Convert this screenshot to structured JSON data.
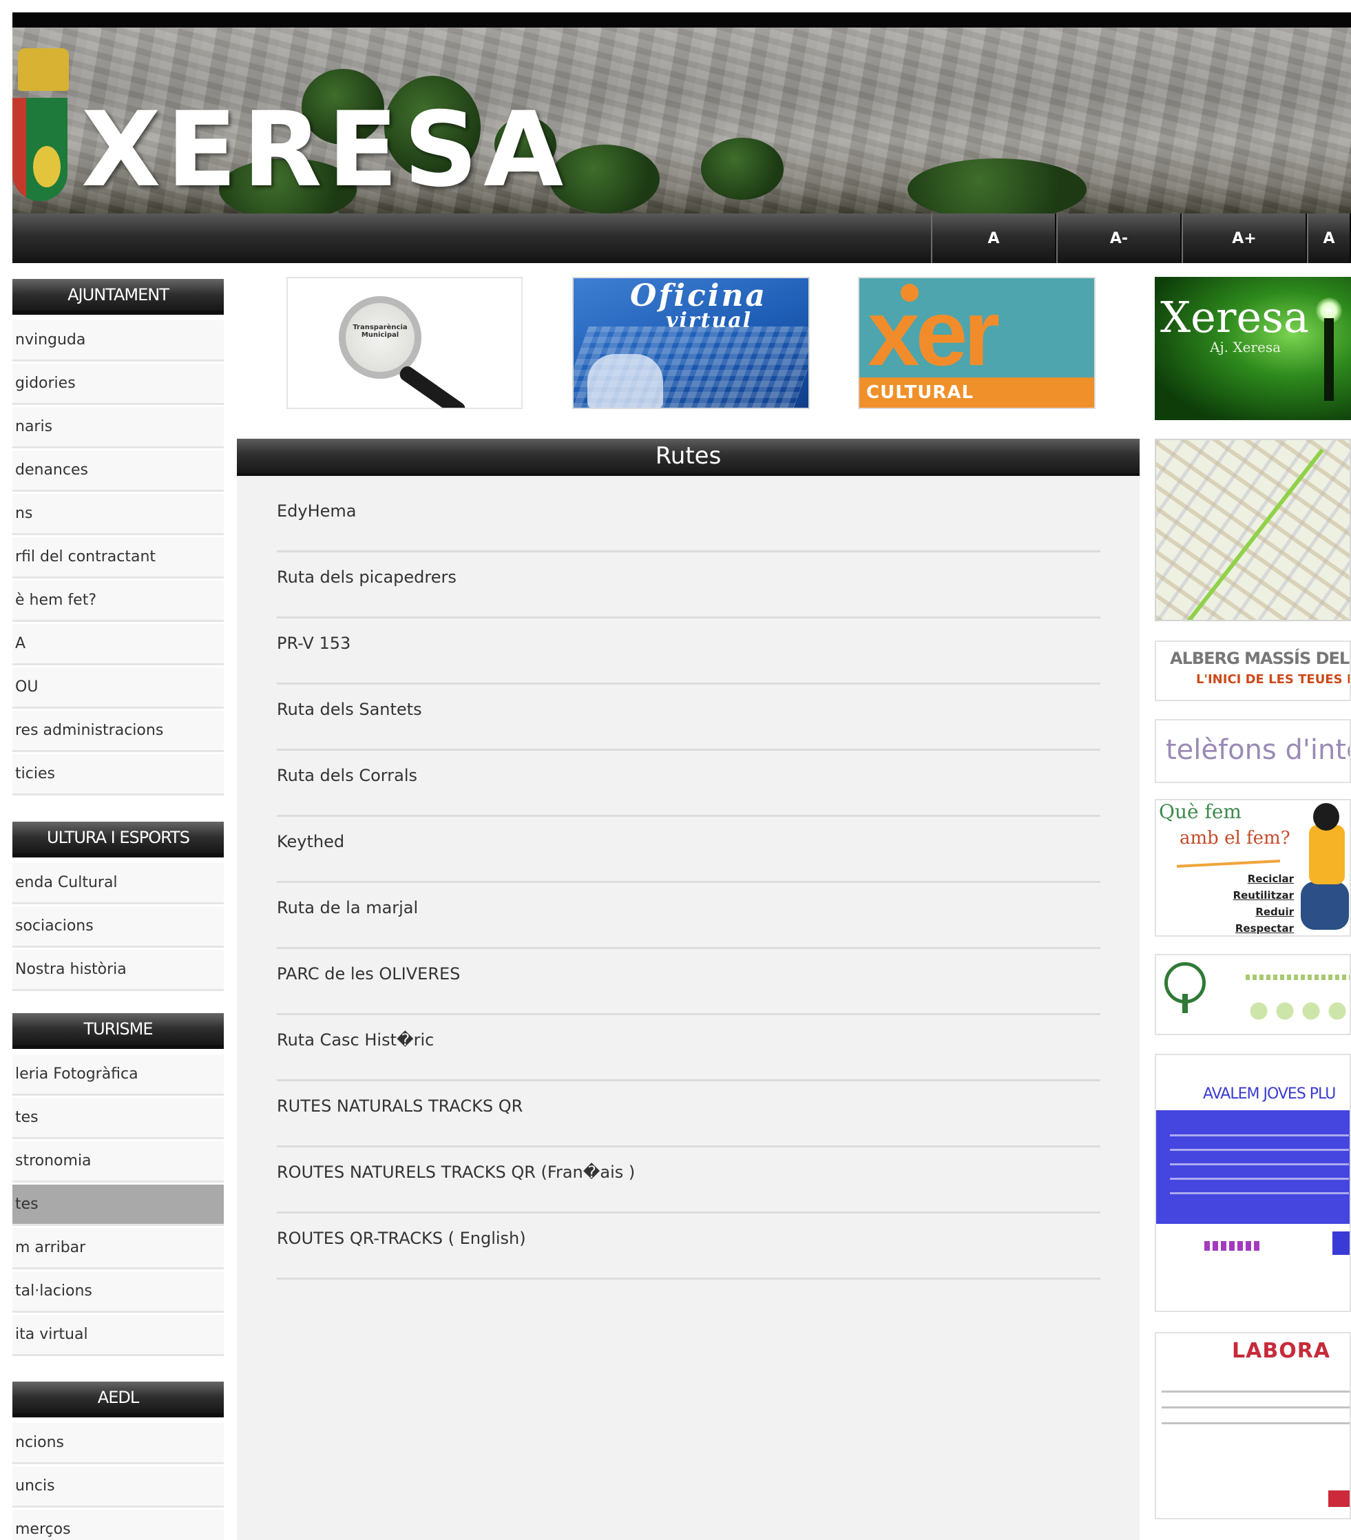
{
  "site": {
    "title": "XERESA"
  },
  "font_size_buttons": [
    "A",
    "A-",
    "A+",
    "A"
  ],
  "sidebar": {
    "sections": [
      {
        "heading": "AJUNTAMENT",
        "items": [
          {
            "label": "nvinguda"
          },
          {
            "label": "gidories"
          },
          {
            "label": "naris"
          },
          {
            "label": "denances"
          },
          {
            "label": "ns"
          },
          {
            "label": "rfil del contractant"
          },
          {
            "label": "è hem fet?"
          },
          {
            "label": "A"
          },
          {
            "label": "OU"
          },
          {
            "label": "res administracions"
          },
          {
            "label": "ticies"
          }
        ]
      },
      {
        "heading": "ULTURA I ESPORTS",
        "items": [
          {
            "label": "enda Cultural"
          },
          {
            "label": "sociacions"
          },
          {
            "label": "Nostra història"
          }
        ]
      },
      {
        "heading": "TURISME",
        "items": [
          {
            "label": "leria Fotogràfica"
          },
          {
            "label": "tes"
          },
          {
            "label": "stronomia"
          },
          {
            "label": "tes",
            "active": true
          },
          {
            "label": "m arribar"
          },
          {
            "label": "tal·lacions"
          },
          {
            "label": "ita virtual"
          }
        ]
      },
      {
        "heading": "AEDL",
        "items": [
          {
            "label": "ncions"
          },
          {
            "label": "uncis"
          },
          {
            "label": "merços"
          }
        ]
      }
    ]
  },
  "banners": {
    "transparencia": {
      "label": "Transparència Municipal",
      "icon": "magnifier-icon"
    },
    "oficina": {
      "line1": "Oficina",
      "line2": "virtual"
    },
    "xer": {
      "word": "xer",
      "tag": "CULTURAL"
    }
  },
  "main": {
    "heading": "Rutes",
    "routes": [
      "EdyHema",
      "Ruta dels picapedrers",
      "PR-V 153",
      "Ruta dels Santets",
      "Ruta dels Corrals",
      "Keythed",
      "Ruta de la marjal",
      "PARC de les OLIVERES",
      "Ruta Casc Hist�ric",
      "RUTES NATURALS TRACKS QR",
      "ROUTES NATURELS TRACKS QR (Fran�ais )",
      "ROUTES QR-TRACKS ( English)"
    ]
  },
  "right_column": {
    "tv": {
      "big": "Xeresa",
      "small": "Aj. Xeresa"
    },
    "map": {
      "label": "town map"
    },
    "alberg": {
      "line1": "ALBERG MASSÍS DEL MONT",
      "line2": "L'INICI DE LES TEUES RUT"
    },
    "telefons": {
      "label": "telèfons d'inte"
    },
    "que_fem": {
      "line1": "Què fem",
      "line2": "amb el fem?",
      "list": [
        "Reciclar",
        "Reutilitzar",
        "Reduir",
        "Respectar"
      ]
    },
    "jovens": {
      "title": "AVALEM JOVES PLU"
    },
    "labora": {
      "title": "LABORA"
    }
  },
  "colors": {
    "header_bar": "#060606",
    "toolbar_dark": "#141414",
    "panel_bg": "#f2f2f2",
    "active_item": "#a9a9a9",
    "xer_orange": "#f28c2b",
    "xer_teal": "#4ea5ad"
  }
}
